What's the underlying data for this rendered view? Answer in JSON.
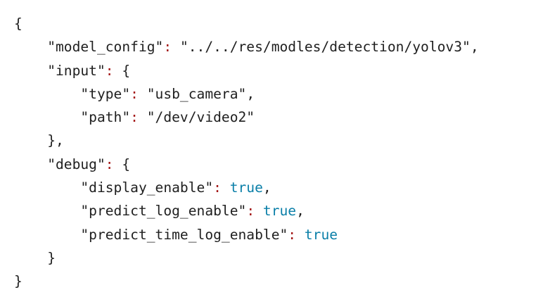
{
  "code": {
    "open_brace": "{",
    "close_brace": "}",
    "model_config": {
      "key": "\"model_config\"",
      "colon": ":",
      "value": "\"../../res/modles/detection/yolov3\"",
      "comma": ","
    },
    "input": {
      "key": "\"input\"",
      "colon": ":",
      "open": "{",
      "close": "},",
      "type": {
        "key": "\"type\"",
        "colon": ":",
        "value": "\"usb_camera\"",
        "comma": ","
      },
      "path": {
        "key": "\"path\"",
        "colon": ":",
        "value": "\"/dev/video2\""
      }
    },
    "debug": {
      "key": "\"debug\"",
      "colon": ":",
      "open": "{",
      "close": "}",
      "display_enable": {
        "key": "\"display_enable\"",
        "colon": ":",
        "value": "true",
        "comma": ","
      },
      "predict_log_enable": {
        "key": "\"predict_log_enable\"",
        "colon": ":",
        "value": "true",
        "comma": ","
      },
      "predict_time_log_enable": {
        "key": "\"predict_time_log_enable\"",
        "colon": ":",
        "value": "true"
      }
    },
    "colors": {
      "text": "#1f1f1f",
      "colon": "#a31515",
      "boolean": "#0a7fa8"
    }
  }
}
